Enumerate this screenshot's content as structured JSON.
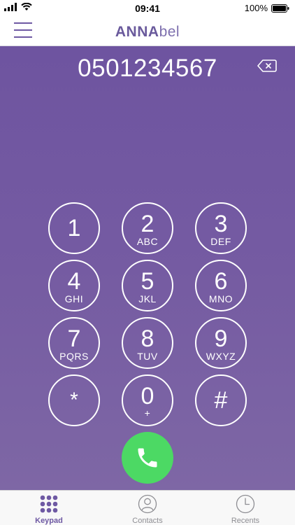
{
  "status_bar": {
    "time": "09:41",
    "battery": "100%",
    "icons": [
      "signal-icon",
      "wifi-icon",
      "battery-icon"
    ]
  },
  "header": {
    "brand_bold": "ANNA",
    "brand_light": "bel",
    "menu_icon": "hamburger-menu-icon"
  },
  "dialer": {
    "number": "0501234567",
    "backspace_icon": "backspace-icon",
    "keys": [
      {
        "digit": "1",
        "letters": ""
      },
      {
        "digit": "2",
        "letters": "ABC"
      },
      {
        "digit": "3",
        "letters": "DEF"
      },
      {
        "digit": "4",
        "letters": "GHI"
      },
      {
        "digit": "5",
        "letters": "JKL"
      },
      {
        "digit": "6",
        "letters": "MNO"
      },
      {
        "digit": "7",
        "letters": "PQRS"
      },
      {
        "digit": "8",
        "letters": "TUV"
      },
      {
        "digit": "9",
        "letters": "WXYZ"
      },
      {
        "digit": "*",
        "letters": ""
      },
      {
        "digit": "0",
        "letters": "+"
      },
      {
        "digit": "#",
        "letters": ""
      }
    ],
    "call_icon": "phone-icon"
  },
  "tab_bar": {
    "tabs": [
      {
        "label": "Keypad",
        "icon": "keypad-grid-icon",
        "active": true
      },
      {
        "label": "Contacts",
        "icon": "contacts-person-icon",
        "active": false
      },
      {
        "label": "Recents",
        "icon": "clock-icon",
        "active": false
      }
    ]
  },
  "colors": {
    "brand": "#6e59a3",
    "dialer_bg_top": "#6e54a0",
    "dialer_bg_bottom": "#7e67a5",
    "call_green": "#4cd964",
    "tab_inactive": "#8e8e93"
  }
}
